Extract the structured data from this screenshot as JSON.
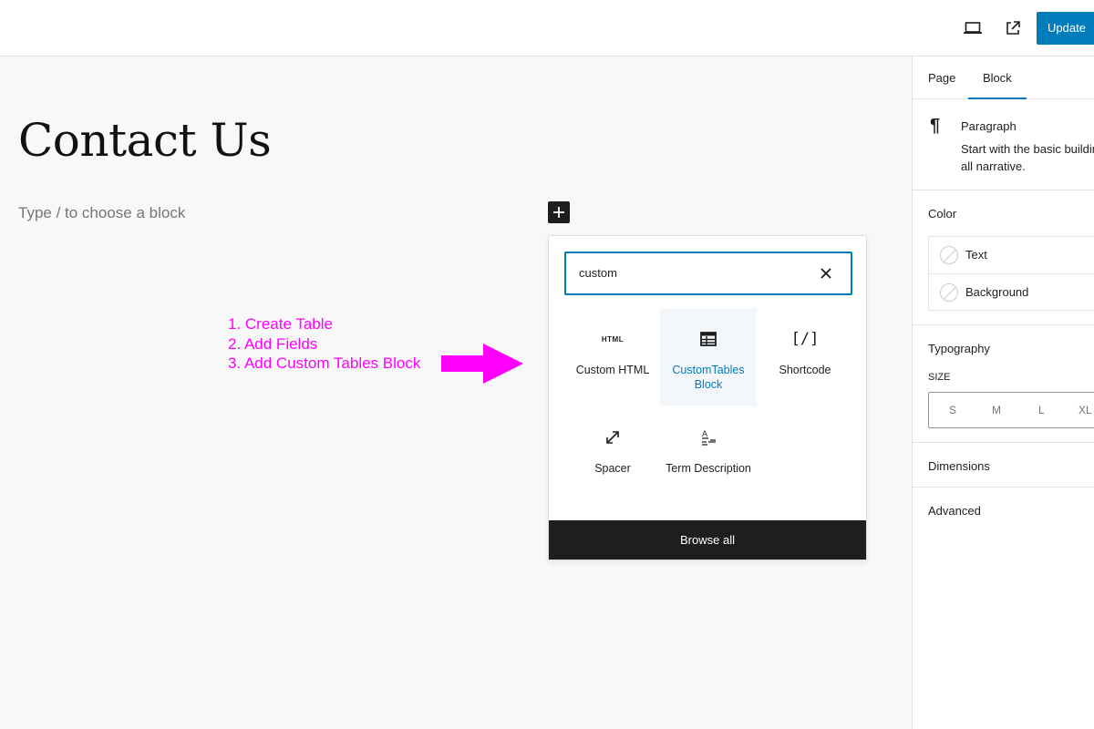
{
  "topbar": {
    "preview_icon": "laptop-icon",
    "view_icon": "external-link-icon",
    "update_label": "Update"
  },
  "editor": {
    "page_title": "Contact Us",
    "placeholder": "Type / to choose a block",
    "add_block_icon": "plus-icon"
  },
  "annotation": {
    "steps": [
      "1. Create Table",
      "2. Add Fields",
      "3. Add Custom Tables Block"
    ],
    "color": "#ff00ff"
  },
  "inserter": {
    "search_value": "custom",
    "clear_icon": "close-icon",
    "blocks": [
      {
        "label": "Custom HTML",
        "icon": "html-icon"
      },
      {
        "label": "CustomTables Block",
        "icon": "table-icon",
        "selected": true
      },
      {
        "label": "Shortcode",
        "icon": "shortcode-icon"
      },
      {
        "label": "Spacer",
        "icon": "resize-icon"
      },
      {
        "label": "Term Description",
        "icon": "term-description-icon"
      }
    ],
    "html_glyph": "HTML",
    "shortcode_glyph": "[/]",
    "browse_all": "Browse all"
  },
  "sidebar": {
    "tabs": [
      "Page",
      "Block"
    ],
    "active_tab": "Block",
    "block": {
      "title": "Paragraph",
      "desc_line1": "Start with the basic building",
      "desc_line2": "all narrative."
    },
    "color": {
      "title": "Color",
      "items": [
        "Text",
        "Background"
      ]
    },
    "typography": {
      "title": "Typography",
      "size_label": "SIZE",
      "sizes": [
        "S",
        "M",
        "L",
        "XL"
      ]
    },
    "dimensions": "Dimensions",
    "advanced": "Advanced"
  },
  "colors": {
    "accent": "#007cba",
    "dark": "#1e1e1e",
    "annotation": "#ff00ff"
  }
}
